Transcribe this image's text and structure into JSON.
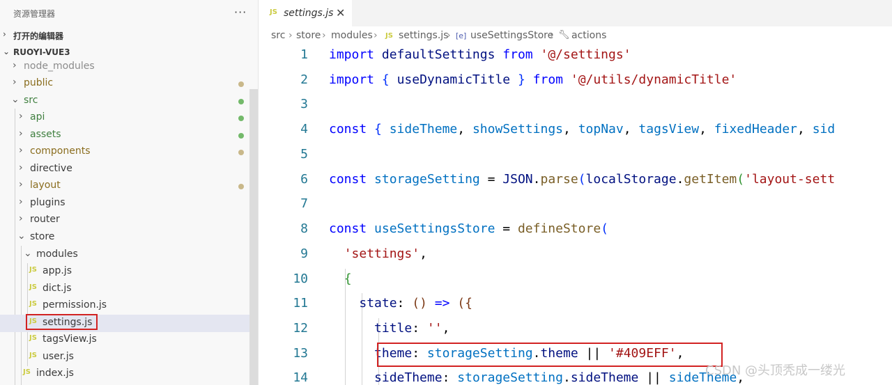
{
  "explorer": {
    "title": "资源管理器",
    "more_label": "···",
    "open_editors_label": "打开的编辑器",
    "project_label": "RUOYI-VUE3",
    "items": [
      {
        "label": "node_modules"
      },
      {
        "label": "public"
      },
      {
        "label": "src"
      },
      {
        "label": "api"
      },
      {
        "label": "assets"
      },
      {
        "label": "components"
      },
      {
        "label": "directive"
      },
      {
        "label": "layout"
      },
      {
        "label": "plugins"
      },
      {
        "label": "router"
      },
      {
        "label": "store"
      },
      {
        "label": "modules"
      },
      {
        "label": "app.js"
      },
      {
        "label": "dict.js"
      },
      {
        "label": "permission.js"
      },
      {
        "label": "settings.js"
      },
      {
        "label": "tagsView.js"
      },
      {
        "label": "user.js"
      },
      {
        "label": "index.js"
      }
    ],
    "js_badge": "JS",
    "colors": {
      "modified": "#c9b88a",
      "untracked": "#73b96a",
      "highlight": "#d22222"
    }
  },
  "tab": {
    "name": "settings.js",
    "badge": "JS"
  },
  "breadcrumb": {
    "items": [
      "src",
      "store",
      "modules",
      "settings.js",
      "useSettingsStore",
      "actions"
    ],
    "separator": "›"
  },
  "code": {
    "line_numbers": [
      "1",
      "2",
      "3",
      "4",
      "5",
      "6",
      "7",
      "8",
      "9",
      "10",
      "11",
      "12",
      "13",
      "14"
    ],
    "l1": {
      "kw": "import",
      "name": "defaultSettings",
      "from": "from",
      "path": "'@/settings'"
    },
    "l2": {
      "kw": "import",
      "open": "{",
      "name": "useDynamicTitle",
      "close": "}",
      "from": "from",
      "path": "'@/utils/dynamicTitle'"
    },
    "l4": {
      "kw": "const",
      "open": "{",
      "a": "sideTheme",
      "b": "showSettings",
      "c": "topNav",
      "d": "tagsView",
      "e": "fixedHeader",
      "f": "sid"
    },
    "l6": {
      "kw": "const",
      "name": "storageSetting",
      "eq": "=",
      "obj": "JSON",
      "fn": "parse",
      "open": "(",
      "obj2": "localStorage",
      "fn2": "getItem",
      "open2": "(",
      "str": "'layout-sett"
    },
    "l8": {
      "kw": "const",
      "name": "useSettingsStore",
      "eq": "=",
      "fn": "defineStore",
      "open": "("
    },
    "l9": {
      "str": "'settings'",
      "comma": ","
    },
    "l10": {
      "open": "{"
    },
    "l11": {
      "key": "state",
      "colon": ":",
      "parens": "()",
      "arrow": "=>",
      "open": "({"
    },
    "l12": {
      "key": "title",
      "colon": ":",
      "str": "''",
      "comma": ","
    },
    "l13": {
      "key": "theme",
      "colon": ":",
      "obj": "storageSetting",
      "dot": ".",
      "prop": "theme",
      "or": "||",
      "str": "'#409EFF'",
      "comma": ","
    },
    "l14": {
      "key": "sideTheme",
      "colon": ":",
      "obj": "storageSetting",
      "dot": ".",
      "prop": "sideTheme",
      "or": "||",
      "val": "sideTheme",
      "comma": ","
    }
  },
  "watermark": "CSDN @头顶秃成一缕光"
}
